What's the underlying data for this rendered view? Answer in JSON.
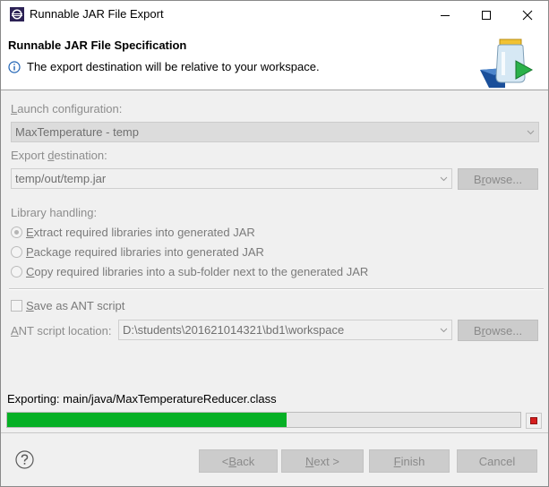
{
  "window": {
    "title": "Runnable JAR File Export"
  },
  "banner": {
    "title": "Runnable JAR File Specification",
    "message": "The export destination will be relative to your workspace."
  },
  "form": {
    "launch_label_pre": "L",
    "launch_label_post": "aunch configuration:",
    "launch_value": "MaxTemperature - temp",
    "export_label_pre": "Export ",
    "export_label_u": "d",
    "export_label_post": "estination:",
    "export_value": "temp/out/temp.jar",
    "browse_pre": "B",
    "browse_u": "r",
    "browse_post": "owse...",
    "library_label": "Library handling:",
    "radio_extract_u": "E",
    "radio_extract_post": "xtract required libraries into generated JAR",
    "radio_package_u": "P",
    "radio_package_post": "ackage required libraries into generated JAR",
    "radio_copy_u": "C",
    "radio_copy_post": "opy required libraries into a sub-folder next to the generated JAR",
    "ant_check_u": "S",
    "ant_check_post": "ave as ANT script",
    "ant_label_u": "A",
    "ant_label_post": "NT script location:",
    "ant_value": "D:\\students\\201621014321\\bd1\\workspace"
  },
  "progress": {
    "status": "Exporting: main/java/MaxTemperatureReducer.class",
    "fraction": 0.545
  },
  "footer": {
    "back_pre": "< ",
    "back_u": "B",
    "back_post": "ack",
    "next_u": "N",
    "next_post": "ext >",
    "finish_u": "F",
    "finish_post": "inish",
    "cancel": "Cancel"
  },
  "colors": {
    "progress_fill": "#06b025",
    "stop": "#d51d1d"
  }
}
